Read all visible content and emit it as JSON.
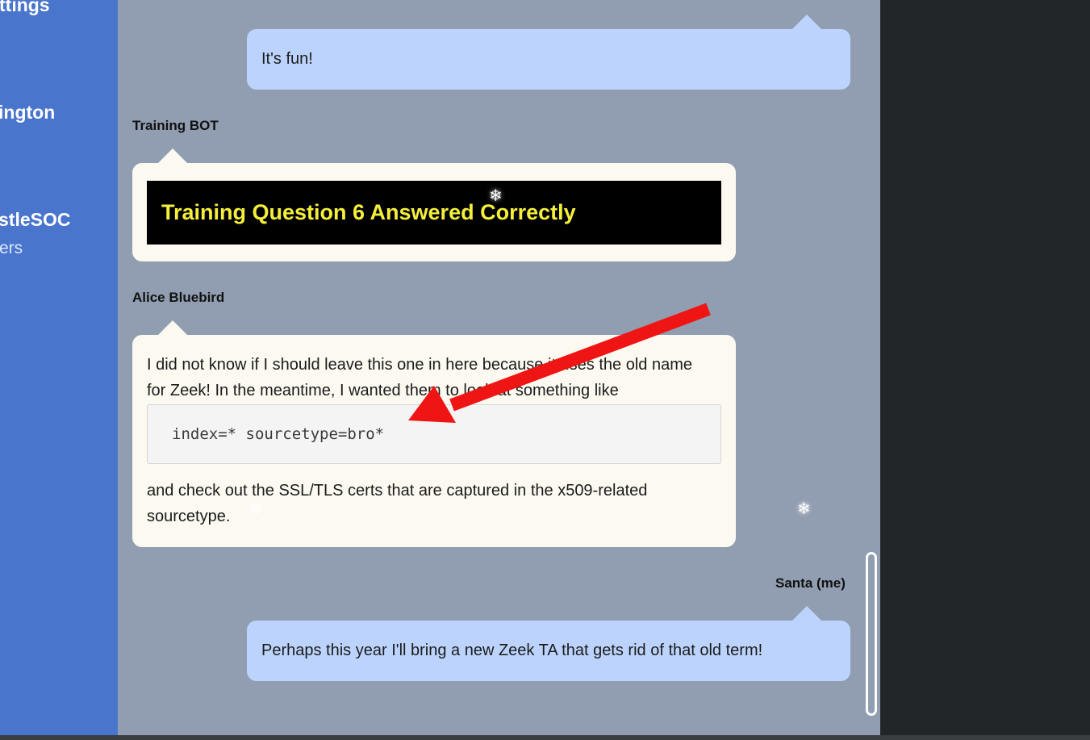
{
  "sidebar": {
    "items": [
      {
        "label": "ttings"
      },
      {
        "label": "ington"
      },
      {
        "label": "stleSOC",
        "sub": "ers"
      }
    ]
  },
  "messages": [
    {
      "sender": "",
      "type": "me",
      "text": "It's fun!"
    },
    {
      "sender": "Training BOT",
      "type": "bot",
      "banner": "Training Question 6 Answered Correctly"
    },
    {
      "sender": "Alice Bluebird",
      "type": "them",
      "text_before": "I did not know if I should leave this one in here because it uses the old name for Zeek! In the meantime, I wanted them to look at something like",
      "code": "index=* sourcetype=bro*",
      "text_after": "and check out the SSL/TLS certs that are captured in the x509-related sourcetype."
    },
    {
      "sender": "Santa (me)",
      "type": "me",
      "text": "Perhaps this year I'll bring a new Zeek TA that gets rid of that old term!"
    }
  ],
  "decorations": {
    "snowflake": "❄",
    "annotation": "red-arrow",
    "annotation_color": "#f01515"
  }
}
